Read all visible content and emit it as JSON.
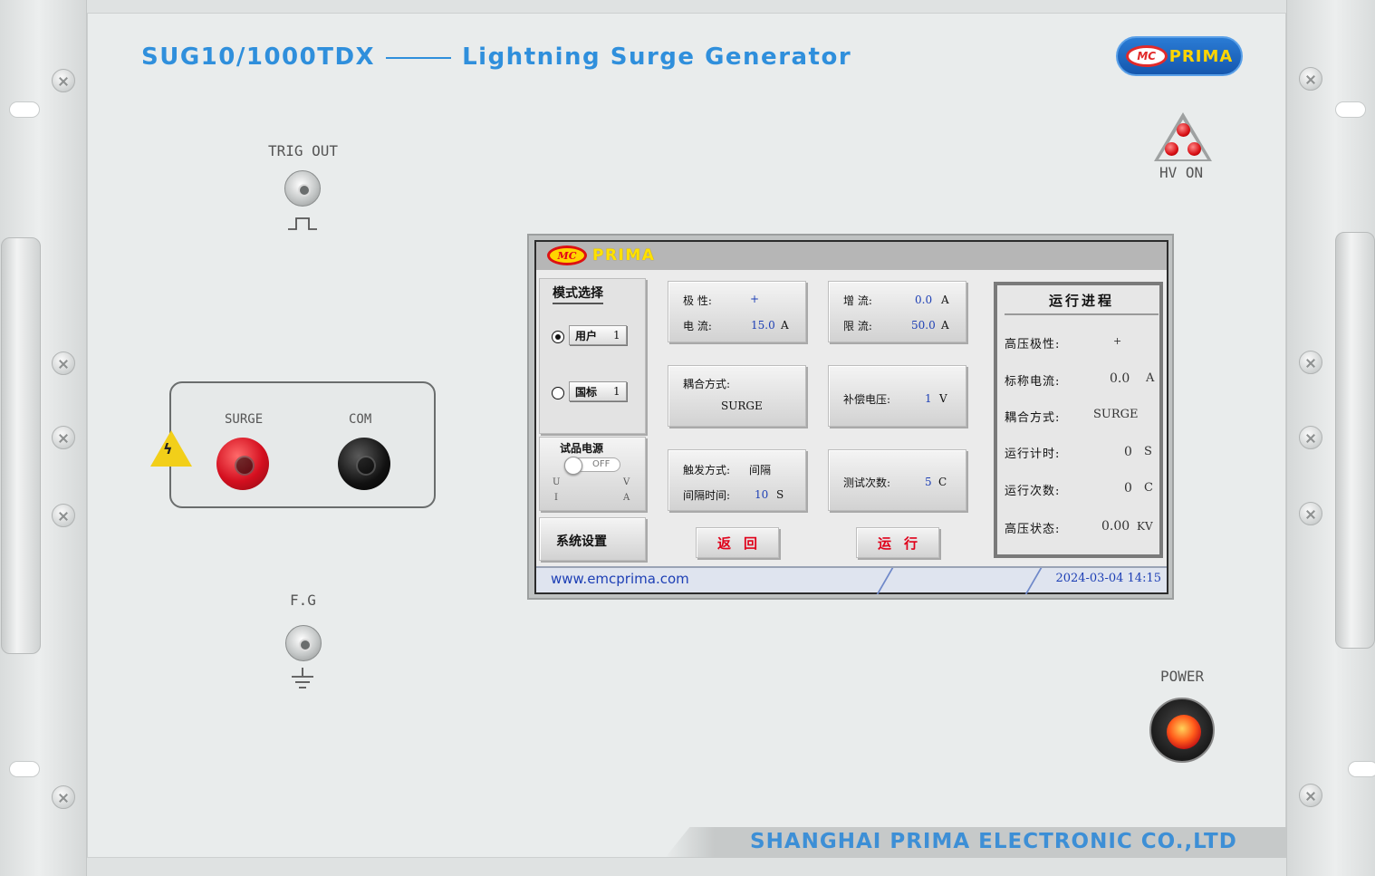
{
  "header": {
    "model": "SUG10/1000TDX",
    "product": "Lightning Surge Generator"
  },
  "brand": {
    "emc": "MC",
    "prima": "PRIMA"
  },
  "front_panel": {
    "trig_out_label": "TRIG OUT",
    "surge_label": "SURGE",
    "com_label": "COM",
    "fg_label": "F.G",
    "hv_on_label": "HV  ON",
    "power_label": "POWER",
    "company": "SHANGHAI PRIMA ELECTRONIC CO.,LTD"
  },
  "screen": {
    "logo": {
      "emc": "MC",
      "prima": "PRIMA"
    },
    "mode": {
      "title": "模式选择",
      "user_label": "用户",
      "user_value": "1",
      "std_label": "国标",
      "std_value": "1",
      "selected": "user"
    },
    "sample_power": {
      "title": "试品电源",
      "toggle_text": "OFF",
      "u": "U",
      "v": "V",
      "i": "I",
      "a": "A"
    },
    "system_settings": "系统设置",
    "params": {
      "polarity_label": "极      性:",
      "polarity_value": "+",
      "current_label": "电      流:",
      "current_value": "15.0",
      "current_unit": "A",
      "increment_label": "增      流:",
      "increment_value": "0.0",
      "increment_unit": "A",
      "limit_label": "限      流:",
      "limit_value": "50.0",
      "limit_unit": "A",
      "coupling_label": "耦合方式:",
      "coupling_value": "SURGE",
      "comp_label": "补偿电压:",
      "comp_value": "1",
      "comp_unit": "V",
      "trigger_label": "触发方式:",
      "trigger_value": "间隔",
      "interval_label": "间隔时间:",
      "interval_value": "10",
      "interval_unit": "S",
      "count_label": "测试次数:",
      "count_value": "5",
      "count_unit": "C"
    },
    "buttons": {
      "back": "返回",
      "run": "运行"
    },
    "progress": {
      "title": "运行进程",
      "rows": [
        {
          "label": "高压极性:",
          "value": "+",
          "unit": ""
        },
        {
          "label": "标称电流:",
          "value": "0.0",
          "unit": "A"
        },
        {
          "label": "耦合方式:",
          "value": "SURGE",
          "unit": ""
        },
        {
          "label": "运行计时:",
          "value": "0",
          "unit": "S"
        },
        {
          "label": "运行次数:",
          "value": "0",
          "unit": "C"
        },
        {
          "label": "高压状态:",
          "value": "0.00",
          "unit": "KV"
        }
      ]
    },
    "footer": {
      "url": "www.emcprima.com",
      "datetime": "2024-03-04  14:15"
    }
  },
  "colors": {
    "title_blue": "#2f8fdc",
    "screen_red": "#e0001a",
    "screen_blue": "#1d3fb5",
    "led_red": "#d80f14"
  },
  "icons": [
    "trigger-pulse-icon",
    "ground-icon",
    "high-voltage-warning-icon",
    "hv-indicator-icon",
    "power-icon"
  ]
}
